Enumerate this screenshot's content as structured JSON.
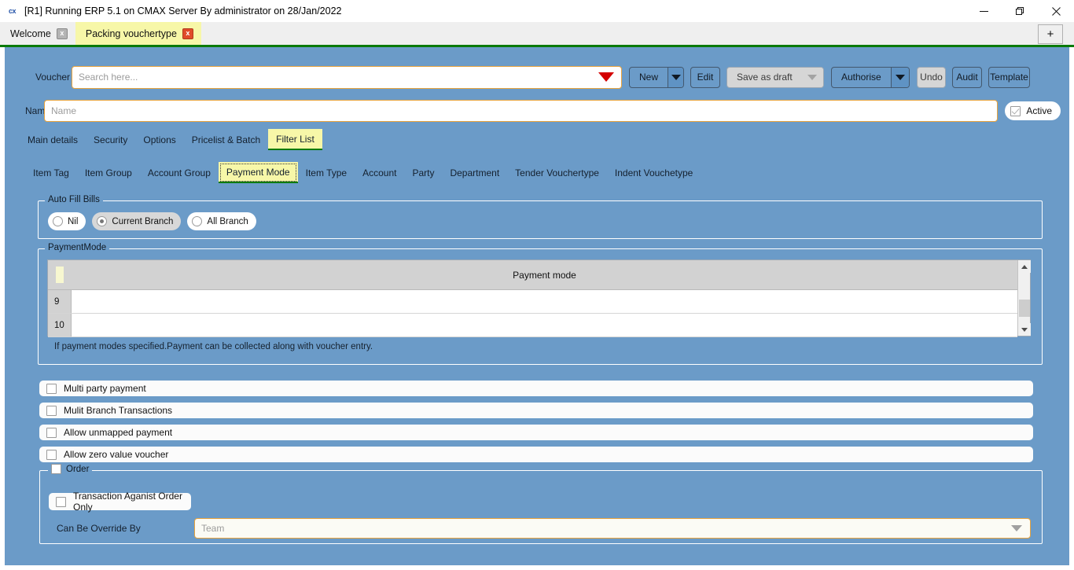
{
  "window": {
    "app_glyph": "cx",
    "title": "[R1] Running ERP 5.1 on CMAX Server By administrator on 28/Jan/2022",
    "controls": {
      "minimize": "minimize-icon",
      "restore": "restore-icon",
      "close": "close-icon"
    }
  },
  "tabstrip": {
    "tabs": [
      {
        "label": "Welcome",
        "active": false,
        "close": "x"
      },
      {
        "label": "Packing vouchertype",
        "active": true,
        "close": "x"
      }
    ],
    "add_label": "+"
  },
  "toolbar": {
    "voucher_type_label": "Voucher Type",
    "voucher_type_placeholder": "Search here...",
    "voucher_type_value": "",
    "new_label": "New",
    "edit_label": "Edit",
    "save_as_draft_label": "Save as draft",
    "authorise_label": "Authorise",
    "undo_label": "Undo",
    "audit_label": "Audit",
    "template_label": "Template"
  },
  "name_row": {
    "label": "Name",
    "placeholder": "Name",
    "value": "",
    "active_label": "Active",
    "active_checked": true
  },
  "main_tabs": [
    {
      "label": "Main details",
      "selected": false
    },
    {
      "label": "Security",
      "selected": false
    },
    {
      "label": "Options",
      "selected": false
    },
    {
      "label": "Pricelist & Batch",
      "selected": false
    },
    {
      "label": "Filter List",
      "selected": true
    }
  ],
  "sub_tabs": [
    {
      "label": "Item Tag",
      "selected": false
    },
    {
      "label": "Item Group",
      "selected": false
    },
    {
      "label": "Account Group",
      "selected": false
    },
    {
      "label": "Payment Mode",
      "selected": true
    },
    {
      "label": "Item Type",
      "selected": false
    },
    {
      "label": "Account",
      "selected": false
    },
    {
      "label": "Party",
      "selected": false
    },
    {
      "label": "Department",
      "selected": false
    },
    {
      "label": "Tender Vouchertype",
      "selected": false
    },
    {
      "label": "Indent Vouchetype",
      "selected": false
    }
  ],
  "auto_fill_bills": {
    "caption": "Auto Fill Bills",
    "options": [
      {
        "label": "Nil",
        "selected": false
      },
      {
        "label": "Current Branch",
        "selected": true
      },
      {
        "label": "All Branch",
        "selected": false
      }
    ]
  },
  "payment_mode": {
    "caption": "PaymentMode",
    "column_header": "Payment mode",
    "rows": [
      {
        "num": "9",
        "value": ""
      },
      {
        "num": "10",
        "value": ""
      }
    ],
    "hint": "If payment modes specified.Payment can be collected along with voucher entry."
  },
  "checkboxes": [
    {
      "label": "Multi party payment",
      "checked": false
    },
    {
      "label": "Mulit Branch Transactions",
      "checked": false
    },
    {
      "label": "Allow unmapped payment",
      "checked": false
    },
    {
      "label": "Allow zero value voucher",
      "checked": false
    }
  ],
  "order": {
    "caption": "Order",
    "checked": false,
    "transaction_label": "Transaction Aganist Order Only",
    "transaction_checked": false,
    "override_label": "Can Be Override By",
    "override_placeholder": "Team",
    "override_value": ""
  },
  "colors": {
    "form_bg": "#6b9bc8",
    "tab_active": "#f7f7a8",
    "tab_underline": "#0a7a0a",
    "input_border": "#e8a33d",
    "red_caret": "#d40000"
  }
}
